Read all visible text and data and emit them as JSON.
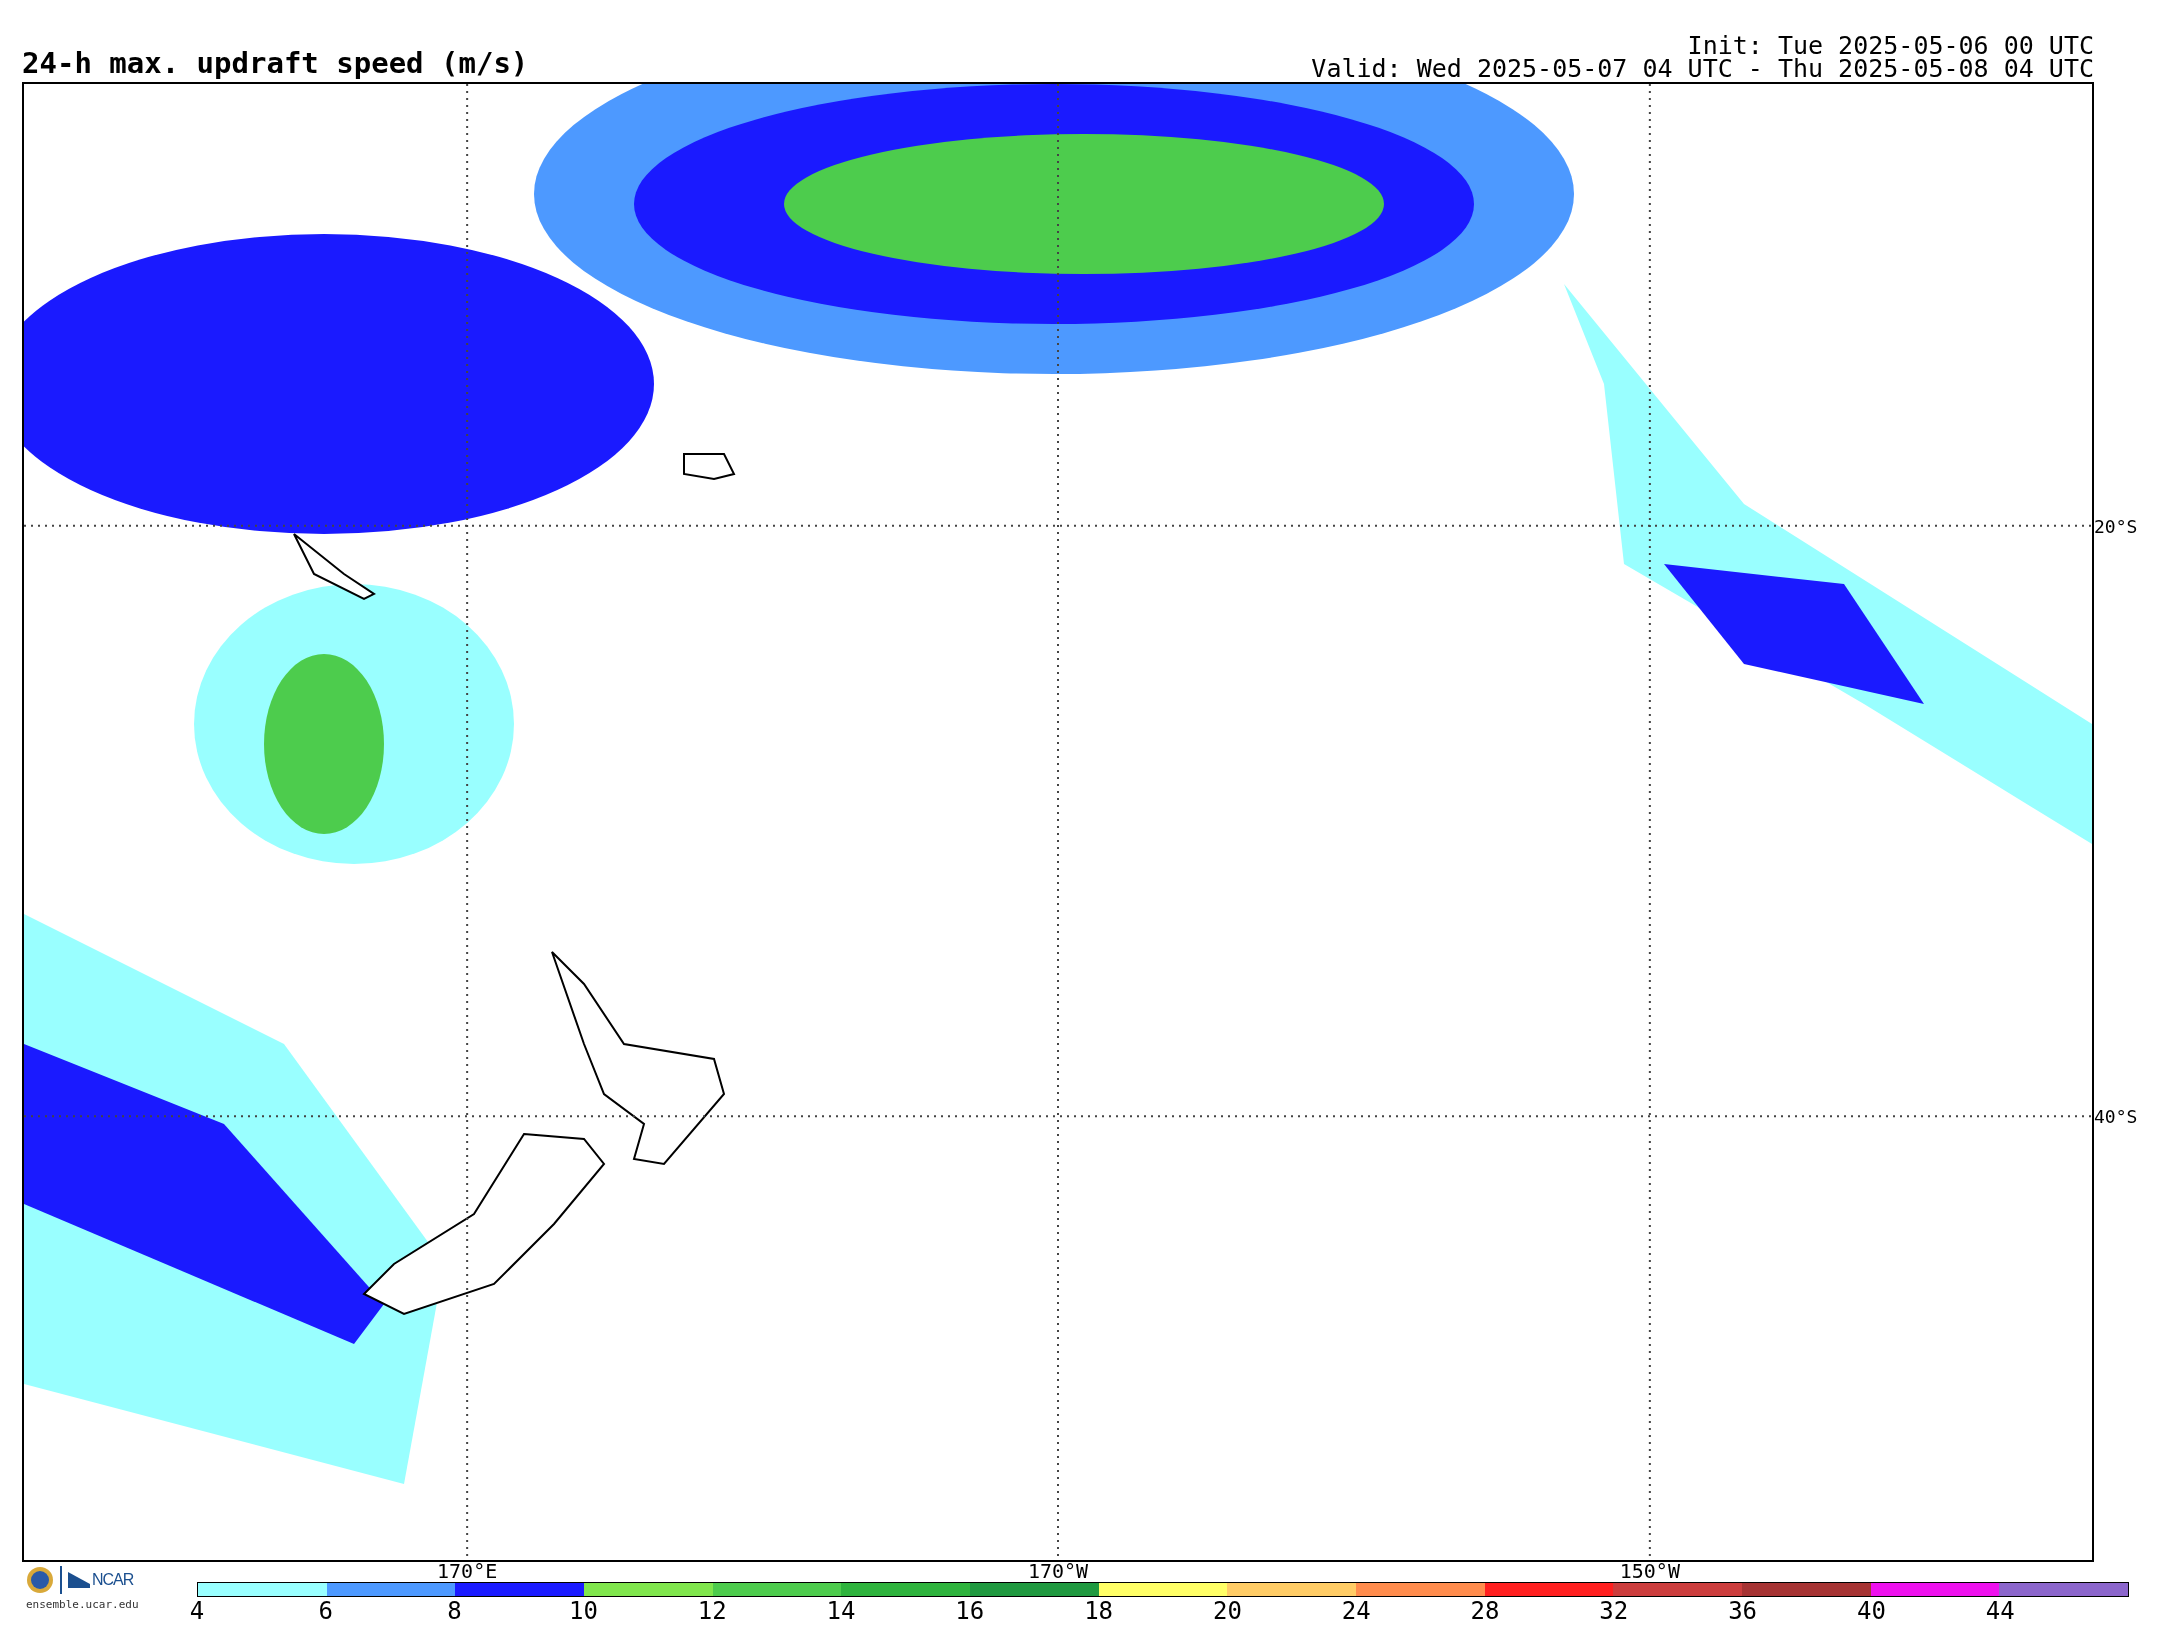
{
  "title": "24-h max. updraft speed (m/s)",
  "init": "Init: Tue 2025-05-06 00 UTC",
  "valid": "Valid: Wed 2025-05-07 04 UTC - Thu 2025-05-08 04 UTC",
  "map": {
    "lat_labels": [
      "20°S",
      "40°S"
    ],
    "lon_labels": [
      "170°E",
      "170°W",
      "150°W"
    ]
  },
  "logo": {
    "name": "NCAR",
    "url": "ensemble.ucar.edu"
  },
  "colorbar": {
    "segments": [
      {
        "color": "#99ffff"
      },
      {
        "color": "#4d99ff"
      },
      {
        "color": "#1a1aff"
      },
      {
        "color": "#80e64d"
      },
      {
        "color": "#4dcc4d"
      },
      {
        "color": "#2eb33d"
      },
      {
        "color": "#1f9940"
      },
      {
        "color": "#ffff66"
      },
      {
        "color": "#ffcc66"
      },
      {
        "color": "#ff8c4d"
      },
      {
        "color": "#ff1f1f"
      },
      {
        "color": "#cc3d3d"
      },
      {
        "color": "#a63333"
      },
      {
        "color": "#ee11ee"
      },
      {
        "color": "#8c66cc"
      }
    ],
    "ticks": [
      "4",
      "6",
      "8",
      "10",
      "12",
      "14",
      "16",
      "18",
      "20",
      "24",
      "28",
      "32",
      "36",
      "40",
      "44"
    ]
  }
}
